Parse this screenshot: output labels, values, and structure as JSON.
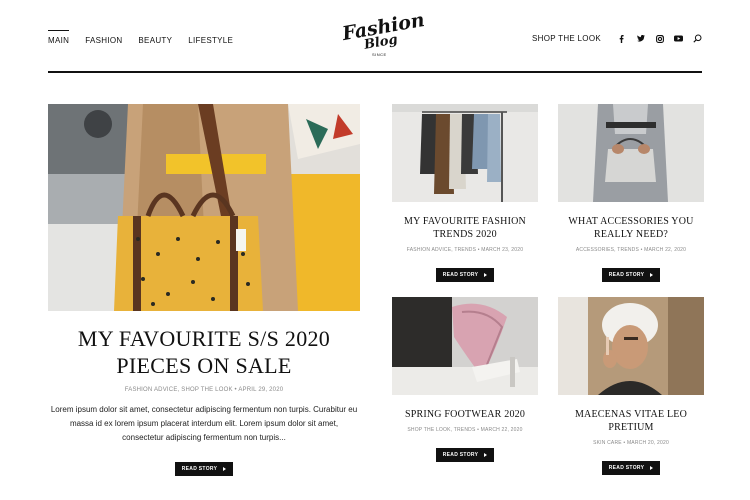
{
  "nav": {
    "left": [
      "MAIN",
      "FASHION",
      "BEAUTY",
      "LIFESTYLE"
    ],
    "shop": "SHOP THE LOOK",
    "social_icons": [
      "facebook-icon",
      "twitter-icon",
      "instagram-icon",
      "youtube-icon"
    ],
    "search_icon": "search-icon"
  },
  "logo": {
    "line1": "Fashion",
    "line2": "Blog",
    "line3": "SINCE"
  },
  "featured": {
    "title": "MY FAVOURITE S/S 2020 PIECES ON SALE",
    "meta": "FASHION ADVICE, SHOP THE LOOK • APRIL 29, 2020",
    "excerpt": "Lorem ipsum dolor sit amet, consectetur adipiscing fermentum non turpis. Curabitur eu massa id ex lorem ipsum placerat interdum elit. Lorem ipsum dolor sit amet, consectetur adipiscing fermentum non turpis...",
    "button": "READ STORY"
  },
  "cards": [
    {
      "title": "MY FAVOURITE FASHION TRENDS 2020",
      "meta": "FASHION ADVICE, TRENDS • MARCH 23, 2020",
      "button": "READ STORY"
    },
    {
      "title": "WHAT ACCESSORIES YOU REALLY NEED?",
      "meta": "ACCESSORIES, TRENDS • MARCH 22, 2020",
      "button": "READ STORY"
    },
    {
      "title": "SPRING FOOTWEAR 2020",
      "meta": "SHOP THE LOOK, TRENDS • MARCH 22, 2020",
      "button": "READ STORY"
    },
    {
      "title": "MAECENAS VITAE LEO PRETIUM",
      "meta": "SKIN CARE • MARCH 20, 2020",
      "button": "READ STORY"
    }
  ],
  "colors": {
    "text": "#111111",
    "meta": "#8a8a8a",
    "button": "#111111",
    "accent_yellow": "#e8b23a"
  }
}
